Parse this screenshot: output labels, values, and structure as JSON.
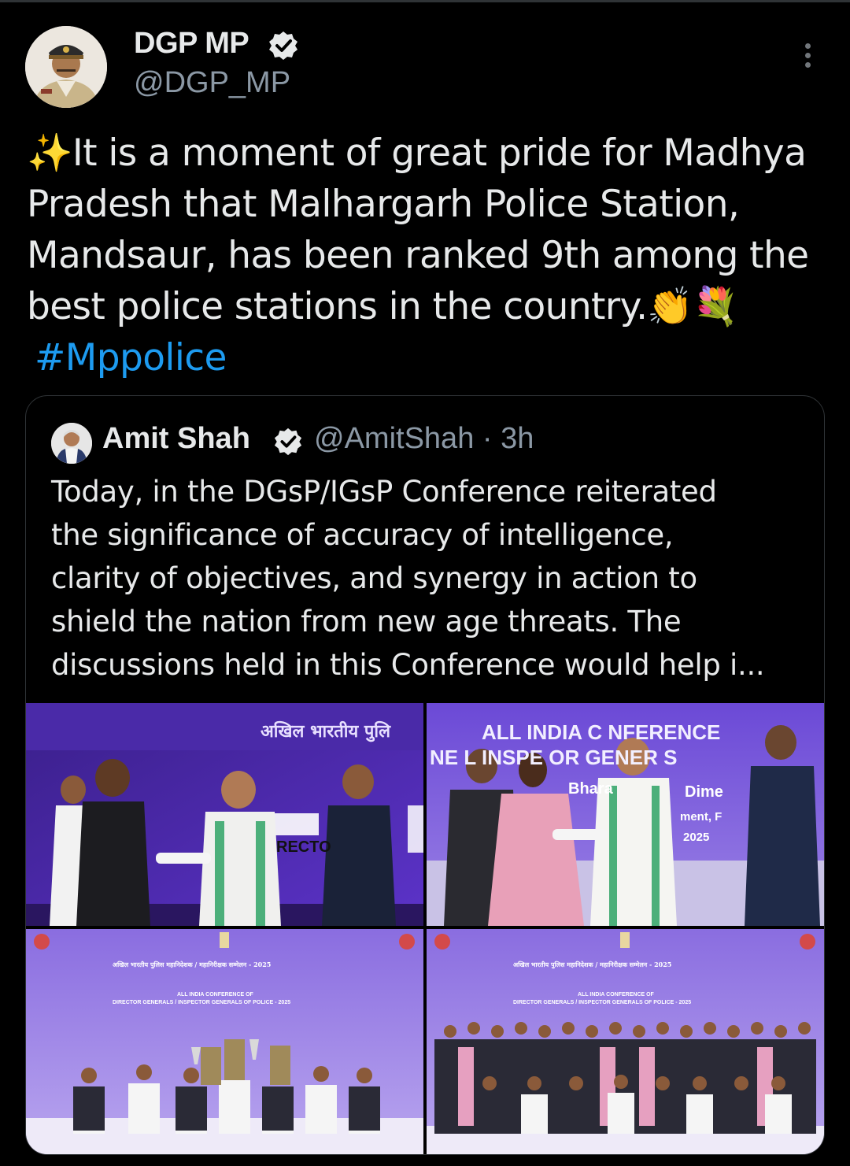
{
  "author": {
    "name": "DGP MP",
    "handle": "@DGP_MP",
    "verified": true,
    "avatar_icon": "police-officer-avatar"
  },
  "tweet": {
    "lines": [
      "✨It is a moment of great pride for Madhya",
      "Pradesh that Malhargarh Police Station,",
      "Mandsaur, has been ranked 9th among the",
      "best police stations in the country.👏💐"
    ],
    "hashtag": "#Mppolice"
  },
  "quoted_tweet": {
    "name": "Amit Shah",
    "handle": "@AmitShah",
    "separator": " · ",
    "time": "3h",
    "verified": true,
    "lines": [
      "Today, in the DGsP/IGsP Conference reiterated",
      "the significance of accuracy of intelligence,",
      "clarity of objectives, and synergy in action to",
      "shield the nation from new age threats. The",
      "discussions held in this Conference would help i..."
    ]
  },
  "media": {
    "photo1": {
      "banner_text": "अखिल भारतीय पुलि",
      "side_text": "RECTO"
    },
    "photo2": {
      "banner_line1": "ALL INDIA C  NFERENCE",
      "banner_line2": "NE  L  INSPE  OR GENER  S",
      "sub1": "Bhara",
      "sub2": "Dime",
      "sub3": "ment, F",
      "year": "2025"
    },
    "photo3": {
      "hindi_title": "अखिल भारतीय पुलिस महानिदेशक / महानिरीक्षक सम्मेलन - 2025",
      "english_line1": "ALL INDIA CONFERENCE OF",
      "english_line2": "DIRECTOR GENERALS / INSPECTOR GENERALS OF POLICE - 2025"
    },
    "photo4": {
      "hindi_title": "अखिल भारतीय पुलिस महानिदेशक / महानिरीक्षक सम्मेलन - 2025",
      "english_line1": "ALL INDIA CONFERENCE OF",
      "english_line2": "DIRECTOR GENERALS / INSPECTOR GENERALS OF POLICE - 2025"
    }
  },
  "colors": {
    "background": "#000000",
    "text": "#e7e9ea",
    "secondary": "#8b98a5",
    "link": "#1d9bf0",
    "verified": "#e7e9ea",
    "stage_purple": "#5b3fc4"
  }
}
